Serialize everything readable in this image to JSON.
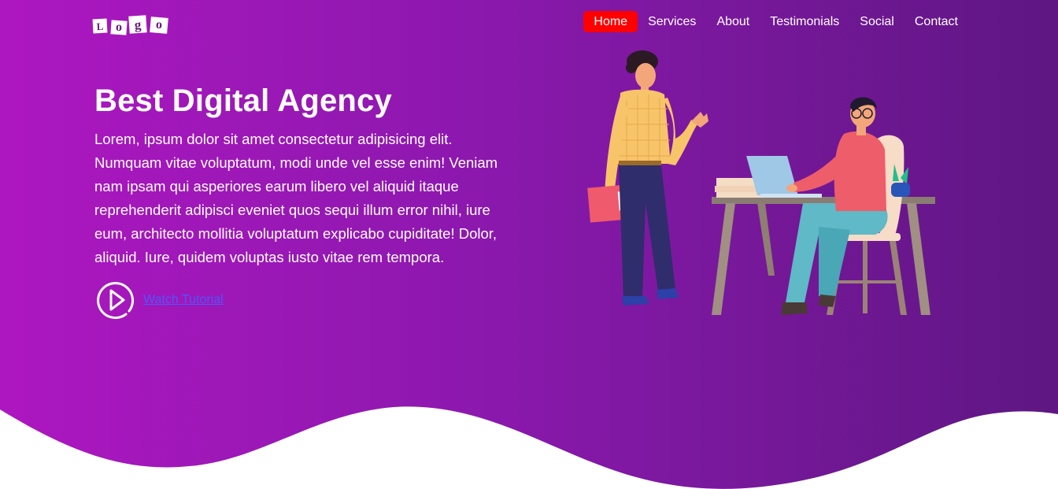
{
  "logo": {
    "letters": [
      "L",
      "o",
      "g",
      "o"
    ]
  },
  "nav": {
    "items": [
      {
        "label": "Home",
        "active": true
      },
      {
        "label": "Services",
        "active": false
      },
      {
        "label": "About",
        "active": false
      },
      {
        "label": "Testimonials",
        "active": false
      },
      {
        "label": "Social",
        "active": false
      },
      {
        "label": "Contact",
        "active": false
      }
    ]
  },
  "hero": {
    "title": "Best Digital Agency",
    "description": "Lorem, ipsum dolor sit amet consectetur adipisicing elit. Numquam vitae voluptatum, modi unde vel esse enim! Veniam nam ipsam qui asperiores earum libero vel aliquid itaque reprehenderit adipisci eveniet quos sequi illum error nihil, iure eum, architecto mollitia voluptatum explicabo cupiditate! Dolor, aliquid. Iure, quidem voluptas iusto vitae rem tempora.",
    "watch_label": "Watch Tutorial",
    "play_icon": "play-circle-icon"
  },
  "colors": {
    "gradient_start": "#ad17c0",
    "gradient_end": "#5e1783",
    "active_nav": "#ff0000",
    "link": "#4f56ff"
  }
}
